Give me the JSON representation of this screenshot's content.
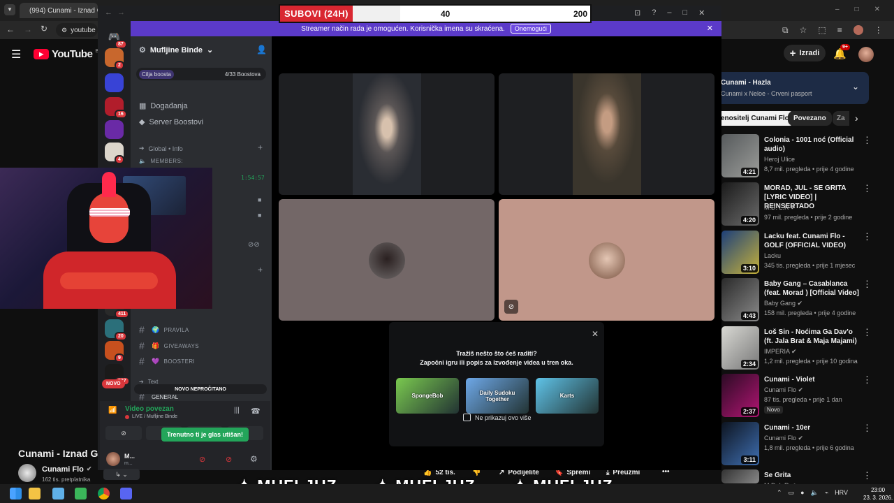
{
  "browser": {
    "tab_title": "(994) Cunami - Iznad Geta",
    "url": "youtube",
    "title_controls": [
      "–",
      "□",
      "✕"
    ]
  },
  "youtube": {
    "logo": "YouTube",
    "logo_region": "BA",
    "create_label": "Izradi",
    "notification_count": "9+",
    "video_title": "Cunami - Iznad Geta",
    "channel_name": "Cunami Flo",
    "subscribers": "162 tis. pretplatnika",
    "likes": "52 tis.",
    "share_label": "Podijelite",
    "save_label": "Spremi",
    "download_label": "Preuzmi",
    "playlist_title": "Cunami - Hazla",
    "playlist_sub": "Cunami x Neloe - Crveni pasport",
    "chips": [
      "Izvođač Cunami Flo",
      "Povezano",
      "Za"
    ],
    "chip_first_visible": "enositelj Cunami Flo",
    "chip_third_visible": "Za",
    "recommendations": [
      {
        "title": "Colonia - 1001 noć (Official audio)",
        "channel": "Heroj Ulice",
        "meta": "8,7 mil. pregleda • prije 4 godine",
        "duration": "4:21",
        "verified": false
      },
      {
        "title": "MORAD, JUL - SE GRITA [LYRIC VIDEO] | REINSERTADO",
        "channel": "M.D. L.R",
        "meta": "97 mil. pregleda • prije 2 godine",
        "duration": "4:20",
        "verified": true
      },
      {
        "title": "Lacku feat. Cunami Flo - GOLF (OFFICIAL VIDEO)",
        "channel": "Lacku",
        "meta": "345 tis. pregleda • prije 1 mjesec",
        "duration": "3:10",
        "verified": false
      },
      {
        "title": "Baby Gang – Casablanca (feat. Morad ) [Official Video]",
        "channel": "Baby Gang",
        "meta": "158 mil. pregleda • prije 4 godine",
        "duration": "4:43",
        "verified": true
      },
      {
        "title": "Loš Sin - Noćima Ga Dav'o (ft. Jala Brat & Maja Majami)",
        "channel": "IMPERIA",
        "meta": "1,2 mil. pregleda • prije 10 godina",
        "duration": "2:34",
        "verified": true
      },
      {
        "title": "Cunami - Violet",
        "channel": "Cunami Flo",
        "meta": "87 tis. pregleda • prije 1 dan",
        "duration": "2:37",
        "verified": true,
        "badge": "Novo"
      },
      {
        "title": "Cunami - 10er",
        "channel": "Cunami Flo",
        "meta": "1,8 mil. pregleda • prije 6 godina",
        "duration": "3:11",
        "verified": true
      },
      {
        "title": "Se Grita",
        "channel": "M.D. L.R",
        "meta": "",
        "duration": "",
        "verified": true
      }
    ]
  },
  "overlay": {
    "sub_label": "SUBOVI (24H)",
    "sub_current": "40",
    "sub_goal": "200",
    "sub_progress": 0.2,
    "brand": "MUFLJUZ"
  },
  "discord": {
    "banner_text": "Streamer način rada je omogućen. Korisnička imena su skraćena.",
    "banner_button": "Onemogući",
    "server_name": "Mufljine Binde",
    "boost_goal_label": "Cilja boosta",
    "boost_count": "4/33 Boostova",
    "menu_events": "Događanja",
    "menu_boosts": "Server Boostovi",
    "category_global": "Global • Info",
    "members_label": "MEMBERS:",
    "timestamp": "1:54:57",
    "channels": [
      {
        "name": "PRAVILA",
        "emoji": "🌍"
      },
      {
        "name": "GIVEAWAYS",
        "emoji": "🎁"
      },
      {
        "name": "BOOSTERI",
        "emoji": "💜"
      }
    ],
    "category_text": "Text",
    "channel_general": "GENERAL",
    "new_label": "NOVO",
    "unread_label": "NOVO NEPROČITANO",
    "voice_status": "Video povezan",
    "voice_location": "LIVE / Mufljine Binde",
    "muted_tooltip": "Trenutno ti je glas utišan!",
    "user_name": "M...",
    "user_status": "m...",
    "server_badges": [
      "87",
      "2",
      "",
      "16",
      "",
      "4",
      "411",
      "20",
      "9",
      "537"
    ],
    "activity_prompt_title": "Tražiš nešto što ćeš raditi?",
    "activity_prompt_sub": "Započni igru ili popis za izvođenje videa u tren oka.",
    "activities": [
      {
        "name": "SpongeBob",
        "color": "#7ac94f"
      },
      {
        "name": "Daily Sudoku Together",
        "color": "#6ea8e8"
      },
      {
        "name": "Karts",
        "color": "#5fc3e8"
      }
    ],
    "dont_show": "Ne prikazuj ovo više"
  },
  "taskbar": {
    "time": "23:00",
    "date": "23. 3. 2026.",
    "lang": "HRV"
  },
  "colors": {
    "discord_blurple": "#5b3ac9",
    "discord_green": "#23a55a",
    "youtube_red": "#ff0033",
    "sub_red": "#d92731"
  }
}
